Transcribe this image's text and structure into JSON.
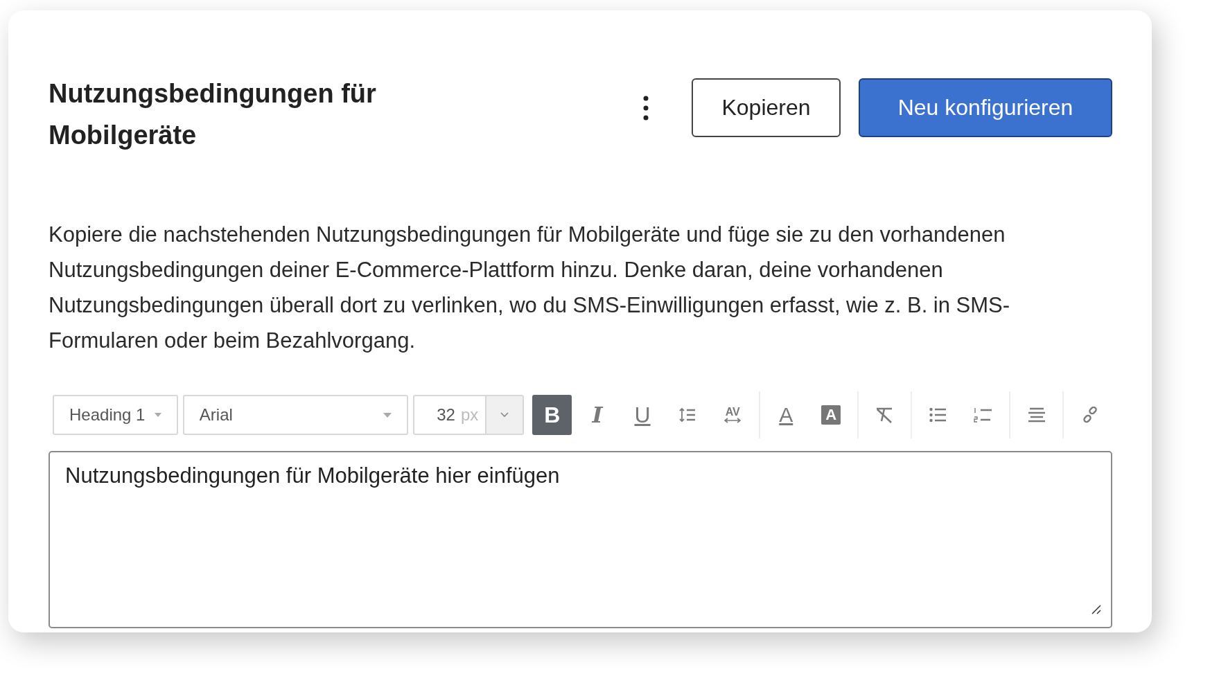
{
  "title": "Nutzungsbedingungen für Mobilgeräte",
  "actions": [
    {
      "label": "Kopieren",
      "kind": "secondary"
    },
    {
      "label": "Neu konfigurieren",
      "kind": "primary"
    }
  ],
  "description": "Kopiere die nachstehenden Nutzungsbedingungen für Mobilgeräte und füge sie zu den vorhandenen Nutzungsbedingungen deiner E-Commerce-Plattform hinzu. Denke daran, deine vorhandenen Nutzungsbedingungen überall dort zu verlinken, wo du SMS-Einwilligungen erfasst, wie z. B. in SMS-Formularen oder beim Bezahlvorgang.",
  "toolbar": {
    "block_style": "Heading 1",
    "font": "Arial",
    "size": "32",
    "size_unit": "px",
    "groups": [
      [
        {
          "kind": "bold",
          "label": "B",
          "selected": true
        },
        {
          "kind": "italic",
          "label": "I",
          "selected": false
        },
        {
          "kind": "underline",
          "label": "U",
          "selected": false
        },
        {
          "kind": "line-height",
          "selected": false
        },
        {
          "kind": "letter-spacing",
          "label": "AV",
          "selected": false
        }
      ],
      [
        {
          "kind": "font-color",
          "label": "A",
          "selected": false
        },
        {
          "kind": "highlight",
          "label": "A",
          "selected": false
        }
      ],
      [
        {
          "kind": "clear-format",
          "selected": false
        }
      ],
      [
        {
          "kind": "bullet-list",
          "selected": false
        },
        {
          "kind": "numbered-list",
          "selected": false
        }
      ],
      [
        {
          "kind": "align",
          "selected": false
        }
      ],
      [
        {
          "kind": "link",
          "selected": false
        }
      ]
    ]
  },
  "editor": {
    "value": "Nutzungsbedingungen für Mobilgeräte hier einfügen"
  }
}
